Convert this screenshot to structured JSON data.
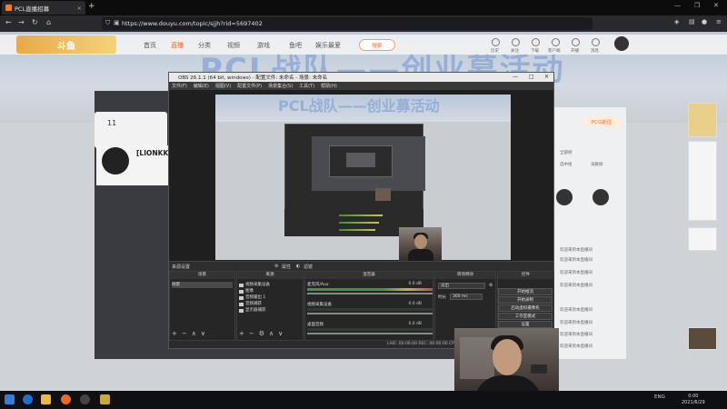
{
  "browser": {
    "tab_title": "PCL直播招募",
    "tab_close": "×",
    "new_tab": "+",
    "url": "https://www.douyu.com/topic/sjjh?rid=5697402",
    "window_min": "—",
    "window_max": "❐",
    "window_close": "✕"
  },
  "douyu": {
    "banner_text": "PCL战队——创业募活动",
    "nav": [
      "首页",
      "直播",
      "分类",
      "视频",
      "游戏",
      "鱼吧",
      "娱乐最爱"
    ],
    "search_label": "搜索",
    "header_icons": [
      "历史",
      "关注",
      "下载",
      "客户端",
      "开播",
      "消息"
    ],
    "room_count": "11",
    "anchor_name": "[LIONKK",
    "pcg_button": "PCG前往",
    "right_panel_items": [
      "全部榜",
      "选中组",
      "贡献榜",
      "知识库",
      "对话"
    ],
    "right_list": [
      "欢迎来到本直播间",
      "欢迎来到本直播间",
      "欢迎来到本直播间",
      "欢迎来到本直播间",
      "欢迎来到本直播间",
      "欢迎来到本直播间",
      "欢迎来到本直播间",
      "欢迎来到本直播间"
    ]
  },
  "obs": {
    "title": "OBS 26.1.1 (64 bit, windows) - 配置文件: 未命名 - 场景: 未命名",
    "menu": [
      "文件(F)",
      "编辑(E)",
      "视图(V)",
      "配置文件(P)",
      "场景集合(S)",
      "工具(T)",
      "帮助(H)"
    ],
    "control_bar_left": "来源设置",
    "control_bar_mid1": "属性",
    "control_bar_mid2": "滤镜",
    "panels": {
      "scenes": {
        "title": "场景",
        "items": [
          "场景"
        ]
      },
      "sources": {
        "title": "来源",
        "items": [
          "视频采集设备",
          "图像",
          "音频输出 1",
          "音频捕获",
          "显示器捕获"
        ]
      },
      "mixer": {
        "title": "混音器",
        "rows": [
          {
            "label": "麦克风/Aux",
            "value": "0.0 dB"
          },
          {
            "label": "视频采集设备",
            "value": "0.0 dB"
          },
          {
            "label": "桌面音频",
            "value": "0.0 dB"
          }
        ]
      },
      "transitions": {
        "title": "转场特效",
        "fade": "淡出",
        "duration_label": "时长",
        "duration_value": "300 ms"
      },
      "controls": {
        "title": "控件",
        "buttons": [
          "开始推流",
          "开始录制",
          "启动虚拟摄像机",
          "工作室模式",
          "设置"
        ]
      }
    },
    "status": "LIVE: 00:00:00   REC: 00:00:00   CPU: 0.3%, 30.00 fps"
  },
  "taskbar": {
    "lang": "ENG",
    "time": "0:00",
    "date": "2021/6/29"
  }
}
